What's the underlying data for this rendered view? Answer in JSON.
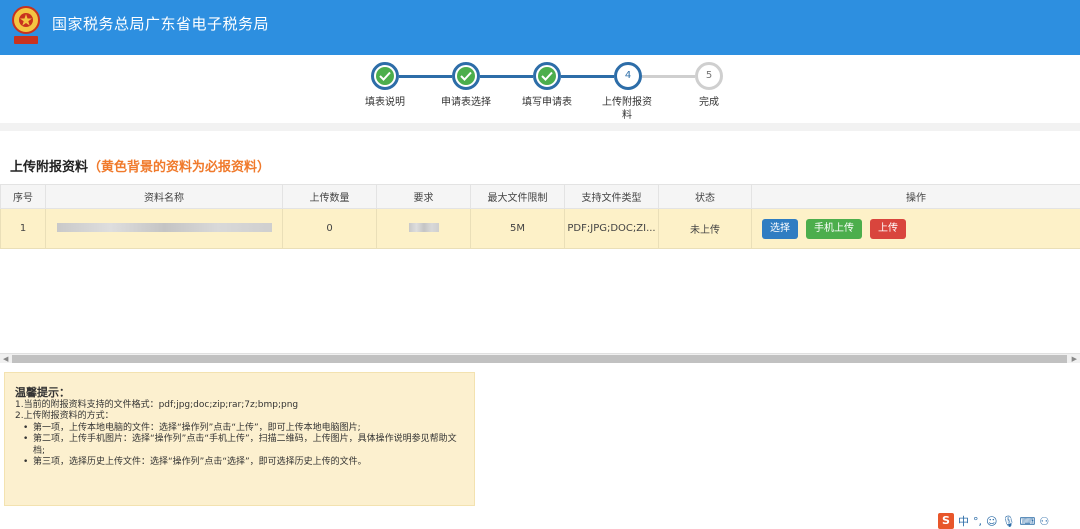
{
  "header": {
    "title": "国家税务总局广东省电子税务局"
  },
  "stepper": {
    "steps": [
      {
        "label": "填表说明",
        "state": "done"
      },
      {
        "label": "申请表选择",
        "state": "done"
      },
      {
        "label": "填写申请表",
        "state": "done"
      },
      {
        "label": "上传附报资料",
        "state": "current",
        "number": "4"
      },
      {
        "label": "完成",
        "state": "todo",
        "number": "5"
      }
    ]
  },
  "section": {
    "title": "上传附报资料",
    "note": "（黄色背景的资料为必报资料）"
  },
  "table": {
    "headers": [
      "序号",
      "资料名称",
      "上传数量",
      "要求",
      "最大文件限制",
      "支持文件类型",
      "状态",
      "操作"
    ],
    "rows": [
      {
        "index": "1",
        "count": "0",
        "max_size": "5M",
        "file_types": "PDF;JPG;DOC;ZI...",
        "status": "未上传",
        "actions": [
          "选择",
          "手机上传",
          "上传"
        ]
      }
    ]
  },
  "tips": {
    "title": "温馨提示：",
    "line1": "1.当前的附报资料支持的文件格式：pdf;jpg;doc;zip;rar;7z;bmp;png",
    "line2": "2.上传附报资料的方式：",
    "bullets": [
      "第一项，上传本地电脑的文件：选择“操作列”点击“上传”，即可上传本地电脑图片;",
      "第二项，上传手机图片：选择“操作列”点击“手机上传”，扫描二维码，上传图片，具体操作说明参见帮助文档;",
      "第三项，选择历史上传文件：选择“操作列”点击“选择”，即可选择历史上传的文件。"
    ]
  },
  "ime": {
    "logo": "S",
    "lang": "中"
  },
  "colors": {
    "header_bg": "#2d8fe0",
    "row_required_bg": "#fdf1c8",
    "status_red": "#e03a2d",
    "btn_select": "#2f7dc2",
    "btn_mobile": "#4cae4c",
    "btn_upload": "#d9453d"
  }
}
